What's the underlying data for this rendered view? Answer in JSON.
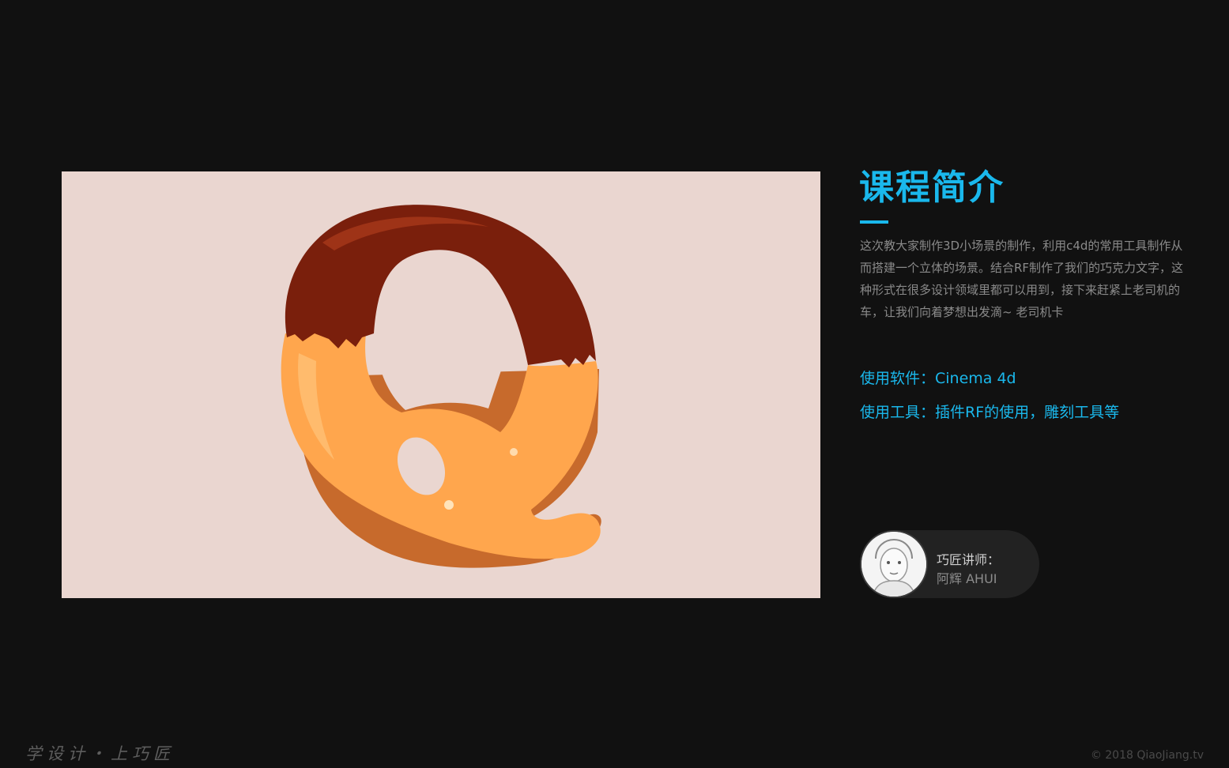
{
  "intro": {
    "title": "课程简介",
    "description": "这次教大家制作3D小场景的制作，利用c4d的常用工具制作从而搭建一个立体的场景。结合RF制作了我们的巧克力文字，这种形式在很多设计领域里都可以用到，接下来赶紧上老司机的车，让我们向着梦想出发滴~ 老司机卡",
    "software": "使用软件：Cinema 4d",
    "tools": "使用工具：插件RF的使用，雕刻工具等"
  },
  "instructor": {
    "label": "巧匠讲师：",
    "name": "阿辉 AHUI"
  },
  "footer": {
    "slogan": "学设计・上巧匠",
    "copyright": "© 2018 QiaoJiang.tv"
  },
  "colors": {
    "accent": "#1ab8ec",
    "background": "#111111",
    "hero_bg": "#ead6d0",
    "chocolate": "#7a1f0c",
    "biscuit": "#ffa64d"
  }
}
